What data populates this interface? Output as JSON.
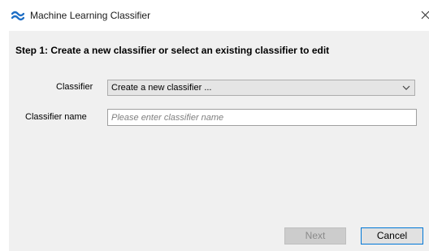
{
  "window": {
    "title": "Machine Learning Classifier",
    "close_glyph": "×",
    "icon": "wave-logo-icon",
    "accent_color": "#0078d7"
  },
  "step": {
    "title": "Step 1:  Create a new classifier or select an existing classifier to edit"
  },
  "form": {
    "classifier_label": "Classifier",
    "classifier_selected": "Create a new classifier ...",
    "name_label": "Classifier name",
    "name_value": "",
    "name_placeholder": "Please enter classifier name"
  },
  "buttons": {
    "next_label": "Next",
    "next_enabled": false,
    "cancel_label": "Cancel"
  }
}
